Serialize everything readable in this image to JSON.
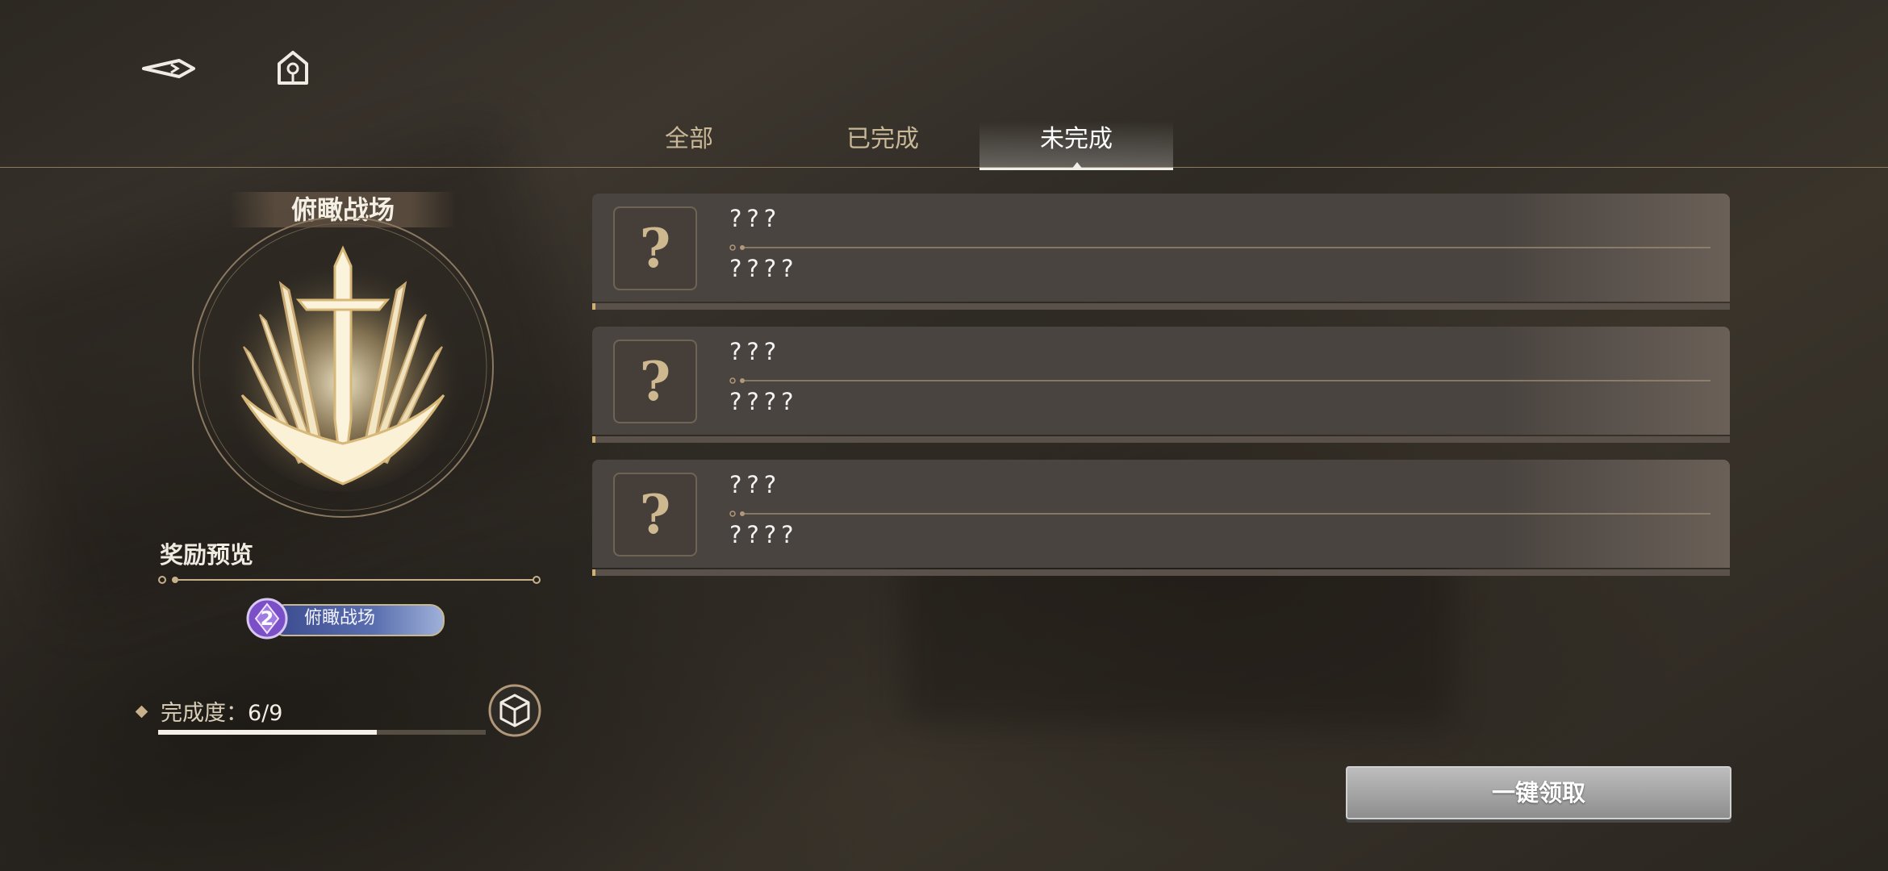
{
  "tabs": [
    {
      "label": "全部",
      "active": false
    },
    {
      "label": "已完成",
      "active": false
    },
    {
      "label": "未完成",
      "active": true
    }
  ],
  "emblem": {
    "title": "俯瞰战场",
    "icon": "swords-emblem-icon"
  },
  "reward": {
    "title": "奖励预览",
    "badge": {
      "count": "2",
      "label": "俯瞰战场",
      "icon": "purple-gem-icon"
    }
  },
  "progress": {
    "label": "完成度：",
    "value": "6/9",
    "fraction": 0.667
  },
  "achievements": [
    {
      "name": "???",
      "desc": "????",
      "icon": "question-mark-icon"
    },
    {
      "name": "???",
      "desc": "????",
      "icon": "question-mark-icon"
    },
    {
      "name": "???",
      "desc": "????",
      "icon": "question-mark-icon"
    }
  ],
  "claim_all_label": "一键领取",
  "colors": {
    "accent": "#c8b08a",
    "card": "#4a4440",
    "active_tab": "#ffffff"
  }
}
